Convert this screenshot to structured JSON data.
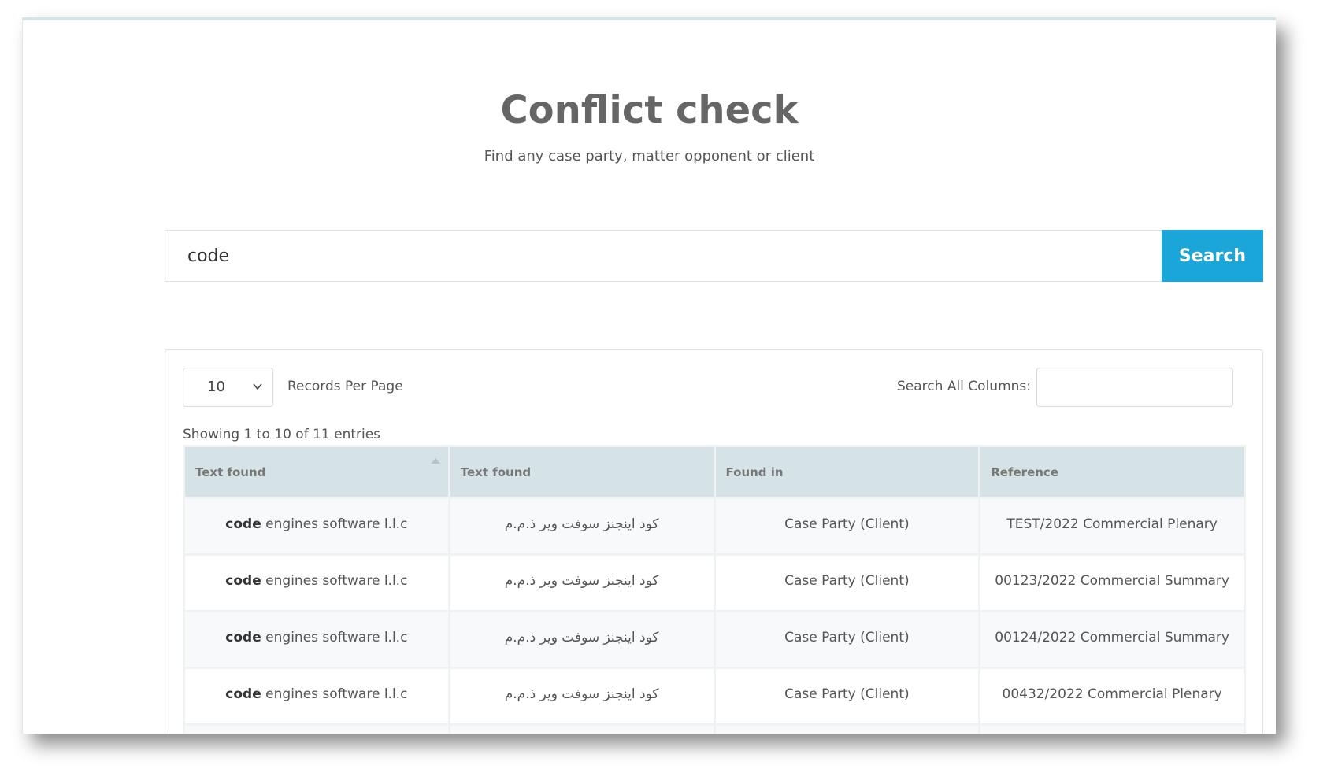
{
  "header": {
    "title": "Conflict check",
    "subtitle": "Find any case party, matter opponent or client"
  },
  "search": {
    "value": "code",
    "button_label": "Search"
  },
  "table_controls": {
    "per_page_value": "10",
    "per_page_label": "Records Per Page",
    "filter_label": "Search All Columns:",
    "filter_value": "",
    "entries_info": "Showing 1 to 10 of 11 entries"
  },
  "table": {
    "columns": [
      "Text found",
      "Text found",
      "Found in",
      "Reference"
    ],
    "rows": [
      {
        "text_keyword": "code",
        "text_rest": "engines software l.l.c",
        "text_ar": "كود اينجنز سوفت وير ذ.م.م",
        "found_in": "Case Party (Client)",
        "reference": "TEST/2022 Commercial Plenary"
      },
      {
        "text_keyword": "code",
        "text_rest": "engines software l.l.c",
        "text_ar": "كود اينجنز سوفت وير ذ.م.م",
        "found_in": "Case Party (Client)",
        "reference": "00123/2022 Commercial Summary"
      },
      {
        "text_keyword": "code",
        "text_rest": "engines software l.l.c",
        "text_ar": "كود اينجنز سوفت وير ذ.م.م",
        "found_in": "Case Party (Client)",
        "reference": "00124/2022 Commercial Summary"
      },
      {
        "text_keyword": "code",
        "text_rest": "engines software l.l.c",
        "text_ar": "كود اينجنز سوفت وير ذ.م.م",
        "found_in": "Case Party (Client)",
        "reference": "00432/2022 Commercial Plenary"
      },
      {
        "text_keyword": "",
        "text_rest": "",
        "text_ar": "",
        "found_in": "",
        "reference": ""
      }
    ]
  },
  "colors": {
    "accent": "#1aa6d9",
    "header_bg": "#d5e3e7"
  }
}
